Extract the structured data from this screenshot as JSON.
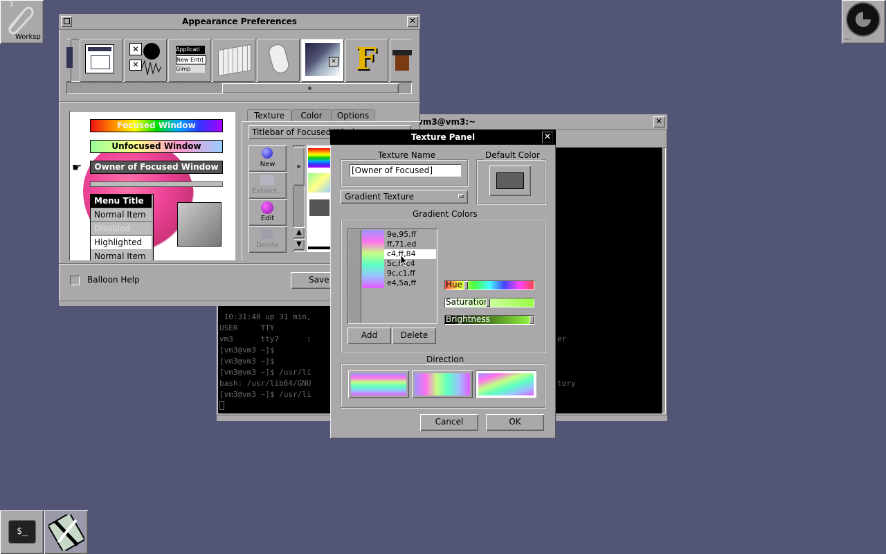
{
  "desktop": {
    "workspace_label": "Worksp",
    "workspace_number": "1",
    "dock_label": "..."
  },
  "appearance": {
    "title": "Appearance Preferences",
    "close": "✕",
    "miniaturize": "▫",
    "preview": {
      "focused": "Focused Window",
      "unfocused": "Unfocused Window",
      "owner": "Owner of Focused Window",
      "menu_title": "Menu Title",
      "normal_item": "Normal Item",
      "disabled_item": "Disabled Item",
      "highlighted": "Highlighted",
      "normal_item2": "Normal Item"
    },
    "tabs": [
      "Texture",
      "Color",
      "Options"
    ],
    "popup_value": "Titlebar of Focused Window",
    "tool_buttons": [
      "New",
      "Extract...",
      "Edit",
      "Delete"
    ],
    "balloon_help": "Balloon Help",
    "save": "Save",
    "icon_labels": {
      "app": "Applicati",
      "new_entry": "New Entr[",
      "gimp": "Gimp"
    }
  },
  "terminal": {
    "title": "vm3@vm3:~",
    "lines": [
      " 10:31:40 up 31 min,",
      "USER     TTY",
      "vm3      tty7      :",
      "[vm3@vm3 ~]$",
      "[vm3@vm3 ~]$",
      "[vm3@vm3 ~]$ /usr/li",
      "bash: /usr/lib64/GNU",
      "[vm3@vm3 ~]$ /usr/li"
    ],
    "right_fragments": [
      "er",
      "tory"
    ]
  },
  "texture_panel": {
    "title": "Texture Panel",
    "texture_name_label": "Texture Name",
    "texture_name_value": "[Owner of Focused]",
    "default_color_label": "Default Color",
    "texture_type": "Gradient Texture",
    "gradient_colors_label": "Gradient Colors",
    "colors": [
      "9e,95,ff",
      "ff,71,ed",
      "c4,ff,84",
      "5c,ff,c4",
      "9c,c1,ff",
      "e4,5a,ff"
    ],
    "selected_color_index": 2,
    "add": "Add",
    "delete": "Delete",
    "hue": "Hue",
    "saturation": "Saturation",
    "brightness": "Brightness",
    "hue_level": 0.22,
    "saturation_level": 0.48,
    "brightness_level": 1.0,
    "direction_label": "Direction",
    "cancel": "Cancel",
    "ok": "OK"
  }
}
